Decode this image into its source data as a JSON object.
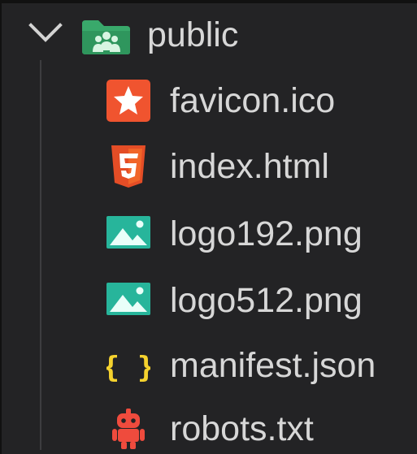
{
  "explorer": {
    "folder": {
      "label": "public",
      "icon": "folder-public-icon",
      "expanded": true
    },
    "files": [
      {
        "label": "favicon.ico",
        "icon": "favicon-star-icon",
        "color": "#f0542f"
      },
      {
        "label": "index.html",
        "icon": "html5-icon",
        "color": "#e44d26"
      },
      {
        "label": "logo192.png",
        "icon": "image-icon",
        "color": "#27b59b"
      },
      {
        "label": "logo512.png",
        "icon": "image-icon",
        "color": "#27b59b"
      },
      {
        "label": "manifest.json",
        "icon": "json-braces-icon",
        "color": "#f5d22e"
      },
      {
        "label": "robots.txt",
        "icon": "robot-icon",
        "color": "#ef4b3d"
      }
    ]
  }
}
